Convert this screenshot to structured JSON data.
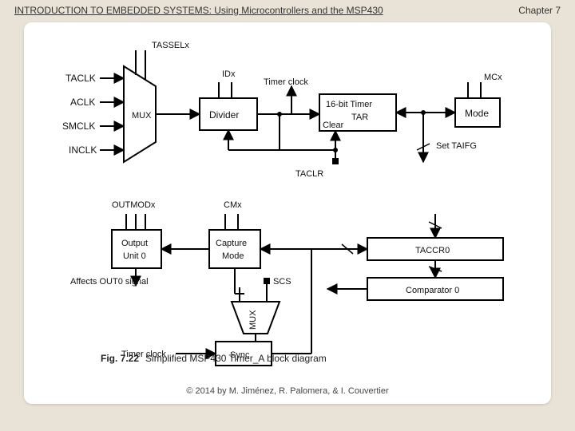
{
  "header_title": "INTRODUCTION TO EMBEDDED SYSTEMS: Using Microcontrollers and the MSP430",
  "chapter": "Chapter 7",
  "footer": "© 2014 by M. Jiménez, R. Palomera, & I. Couvertier",
  "caption_label": "Fig. 7.22",
  "caption_text": "Simplified MSP430 Timer_A block diagram",
  "diagram": {
    "mux1_label": "MUX",
    "mux1_sel": "TASSELx",
    "mux1_in": [
      "TACLK",
      "ACLK",
      "SMCLK",
      "INCLK"
    ],
    "divider": "Divider",
    "divider_sel": "IDx",
    "timer_clock": "Timer clock",
    "tar_line1": "16-bit Timer",
    "tar_line2": "TAR",
    "tar_clear": "Clear",
    "taclr": "TACLR",
    "mode": "Mode",
    "mode_sel": "MCx",
    "taifg": "Set TAIFG",
    "outmod": "OUTMODx",
    "output_unit_l1": "Output",
    "output_unit_l2": "Unit 0",
    "affects": "Affects OUT0 signal",
    "capture_l1": "Capture",
    "capture_l2": "Mode",
    "cmx": "CMx",
    "scs": "SCS",
    "mux2_label": "MUX",
    "sync": "Sync",
    "timer_clock2": "Timer clock",
    "taccr0": "TACCR0",
    "comparator0": "Comparator 0"
  }
}
